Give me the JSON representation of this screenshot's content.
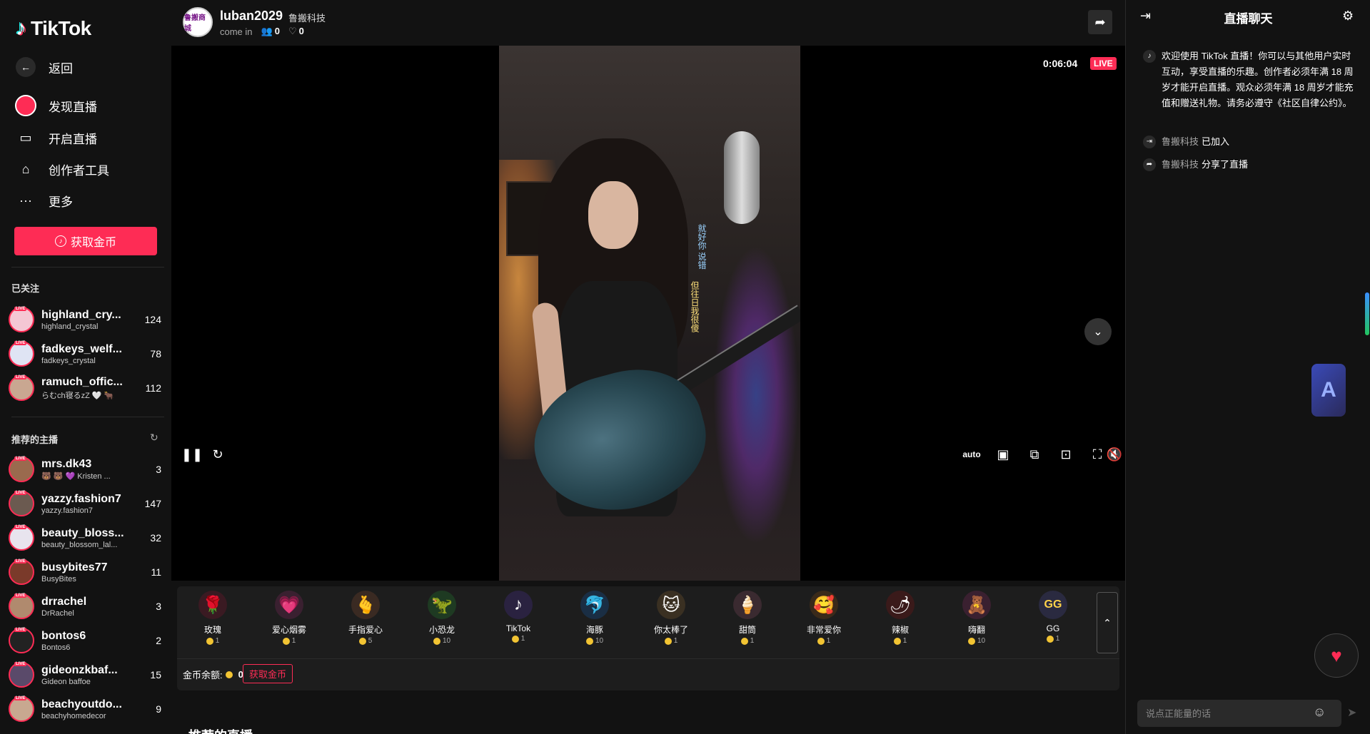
{
  "app": {
    "logo": "TikTok"
  },
  "sidebar": {
    "back": "返回",
    "nav": [
      {
        "label": "发现直播",
        "icon": "discover-live-icon"
      },
      {
        "label": "开启直播",
        "icon": "camera-icon"
      },
      {
        "label": "创作者工具",
        "icon": "creator-tools-icon"
      },
      {
        "label": "更多",
        "icon": "more-icon"
      }
    ],
    "get_coins": "获取金币",
    "following_title": "已关注",
    "following": [
      {
        "name": "highland_cry...",
        "sub": "highland_crystal",
        "count": "124"
      },
      {
        "name": "fadkeys_welf...",
        "sub": "fadkeys_crystal",
        "count": "78"
      },
      {
        "name": "ramuch_offic...",
        "sub": "らむch寝るzZ 🤍 🐂",
        "count": "112"
      }
    ],
    "recommended_title": "推荐的主播",
    "recommended": [
      {
        "name": "mrs.dk43",
        "sub": "🐻 🐻 💜 Kristen ...",
        "count": "3"
      },
      {
        "name": "yazzy.fashion7",
        "sub": "yazzy.fashion7",
        "count": "147"
      },
      {
        "name": "beauty_bloss...",
        "sub": "beauty_blossom_lal...",
        "count": "32"
      },
      {
        "name": "busybites77",
        "sub": "BusyBites",
        "count": "11"
      },
      {
        "name": "drrachel",
        "sub": "DrRachel",
        "count": "3"
      },
      {
        "name": "bontos6",
        "sub": "Bontos6",
        "count": "2"
      },
      {
        "name": "gideonzkbaf...",
        "sub": "Gideon baffoe",
        "count": "15"
      },
      {
        "name": "beachyoutdo...",
        "sub": "beachyhomedecor",
        "count": "9"
      }
    ],
    "live_tag": "LIVE"
  },
  "stream": {
    "host_name": "luban2029",
    "host_org": "鲁搬科技",
    "host_avatar_text": "鲁搬商城",
    "status": "come in",
    "viewers": "0",
    "likes": "0",
    "timer": "0:06:04",
    "live_badge": "LIVE",
    "lyrics_1": "就好你 说错",
    "lyrics_2": "但往日我很傻"
  },
  "gifts": [
    {
      "name": "玫瑰",
      "price": "1",
      "emoji": "🌹",
      "color": "#3a1a22"
    },
    {
      "name": "爱心烟雾",
      "price": "1",
      "emoji": "💗",
      "color": "#3a2030"
    },
    {
      "name": "手指爱心",
      "price": "5",
      "emoji": "🫰",
      "color": "#3a2a22"
    },
    {
      "name": "小恐龙",
      "price": "10",
      "emoji": "🦖",
      "color": "#1e3a22"
    },
    {
      "name": "TikTok",
      "price": "1",
      "emoji": "♪",
      "color": "#2a2240"
    },
    {
      "name": "海豚",
      "price": "10",
      "emoji": "🐬",
      "color": "#1a2e44"
    },
    {
      "name": "你太棒了",
      "price": "1",
      "emoji": "🐱",
      "color": "#3a3022"
    },
    {
      "name": "甜筒",
      "price": "1",
      "emoji": "🍦",
      "color": "#3a2a30"
    },
    {
      "name": "非常爱你",
      "price": "1",
      "emoji": "🥰",
      "color": "#3a2a1a"
    },
    {
      "name": "辣椒",
      "price": "1",
      "emoji": "🌶",
      "color": "#3a1a1a"
    },
    {
      "name": "嗨翻",
      "price": "10",
      "emoji": "🧸",
      "color": "#3a2030"
    },
    {
      "name": "GG",
      "price": "1",
      "emoji": "GG",
      "color": "#2a2a40"
    }
  ],
  "balance": {
    "label": "金币余额:",
    "value": "0",
    "get_coins": "获取金币"
  },
  "recommended_live_title": "推荐的直播",
  "chat": {
    "title": "直播聊天",
    "welcome": "欢迎使用 TikTok 直播！你可以与其他用户实时互动，享受直播的乐趣。创作者必须年满 18 周岁才能开启直播。观众必须年满 18 周岁才能充值和赠送礼物。请务必遵守《社区自律公约》。",
    "events": [
      {
        "user": "鲁搬科技",
        "action": "已加入",
        "icon": "join-icon"
      },
      {
        "user": "鲁搬科技",
        "action": "分享了直播",
        "icon": "share-icon"
      }
    ],
    "placeholder": "说点正能量的话"
  },
  "colors": {
    "accent": "#fe2c55",
    "background": "#121212",
    "panel": "#1d1d1d",
    "coin": "#f2c433"
  }
}
